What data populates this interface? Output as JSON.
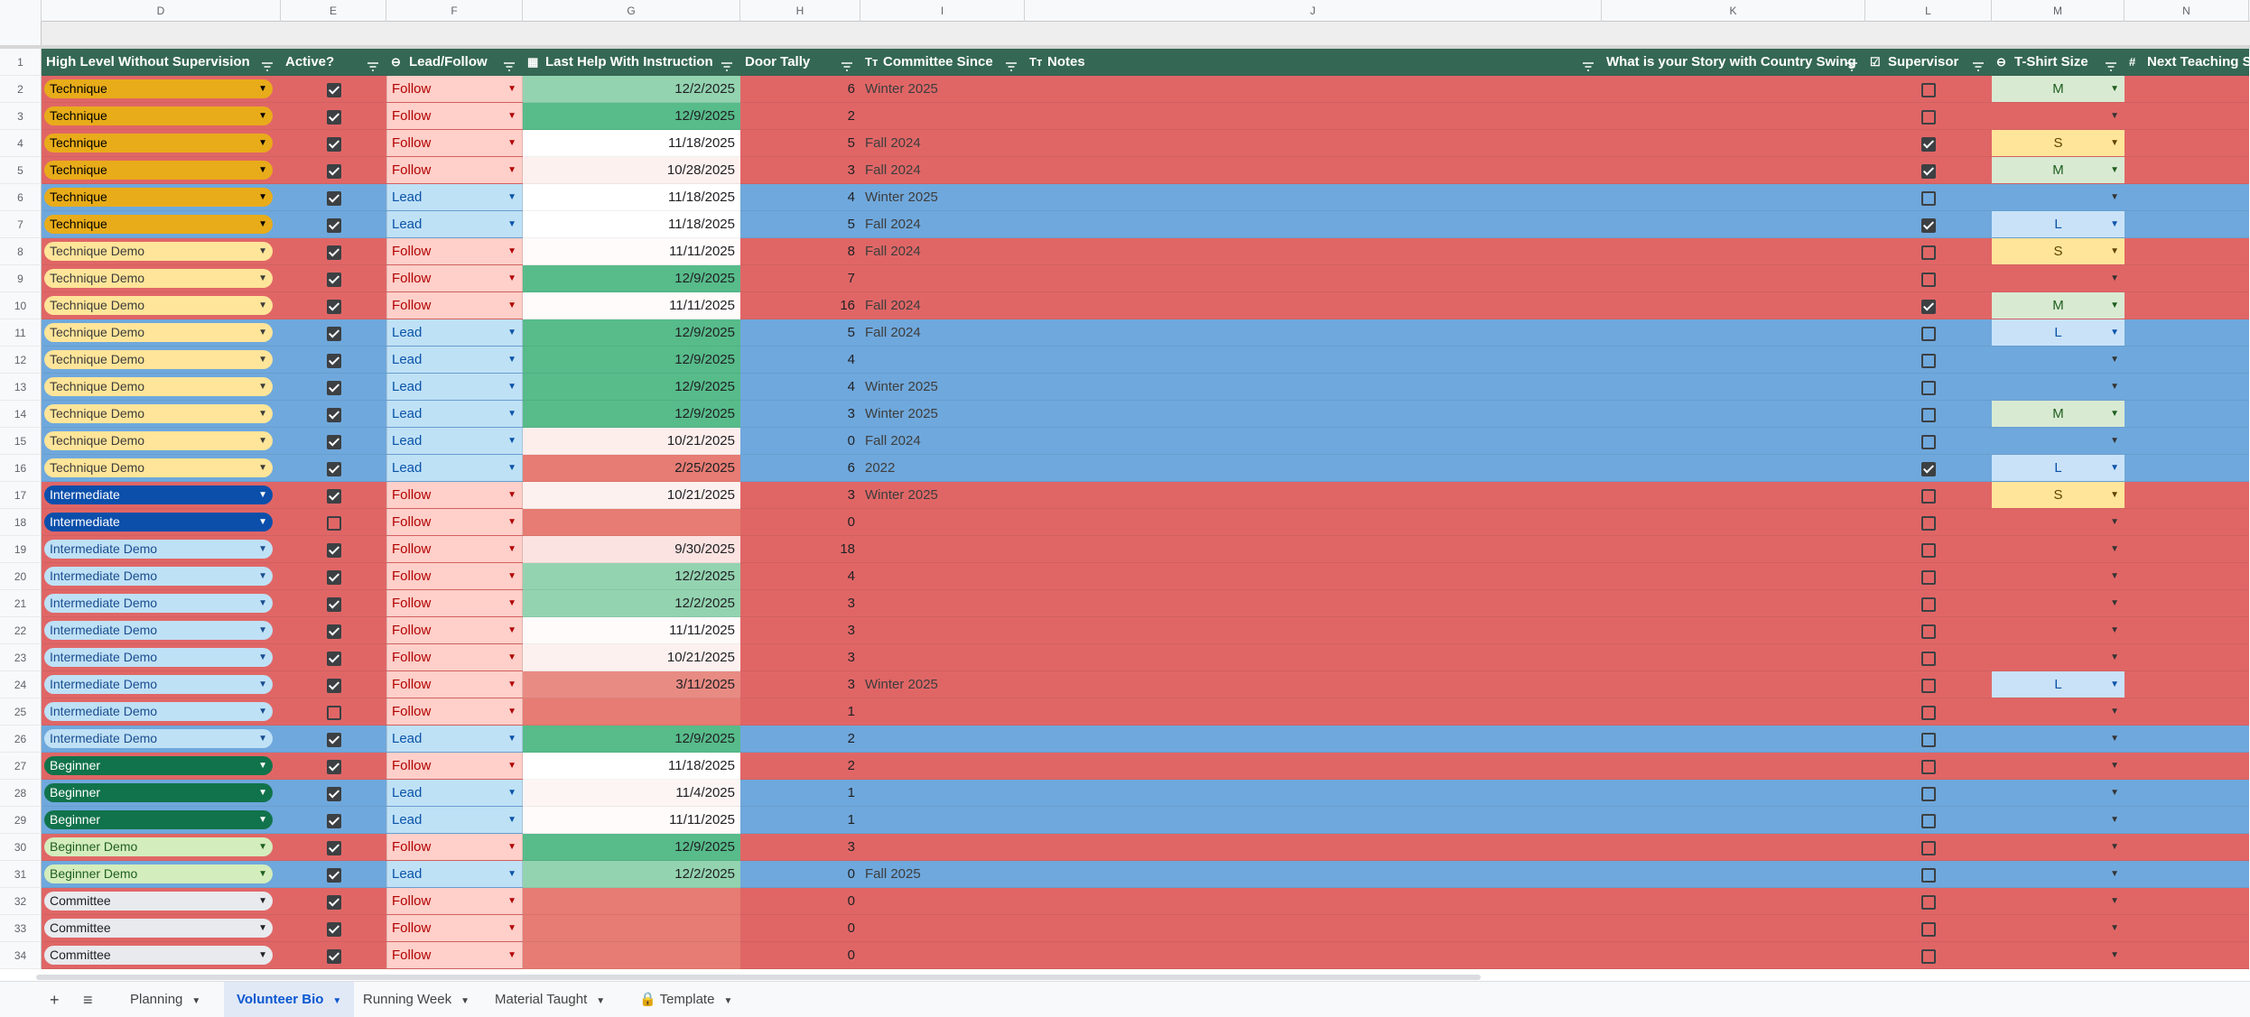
{
  "column_letters": [
    "D",
    "E",
    "F",
    "G",
    "H",
    "I",
    "J",
    "K",
    "L",
    "M",
    "N"
  ],
  "headers": [
    {
      "label": "High Level Without Supervision",
      "icon": ""
    },
    {
      "label": "Active?",
      "icon": ""
    },
    {
      "label": "Lead/Follow",
      "icon": "dropdown-chip-icon"
    },
    {
      "label": "Last Help With Instruction",
      "icon": "calendar-icon"
    },
    {
      "label": "Door Tally",
      "icon": ""
    },
    {
      "label": "Committee Since",
      "icon": "text-type-icon"
    },
    {
      "label": "Notes",
      "icon": "text-type-icon"
    },
    {
      "label": "What is your Story with Country Swing",
      "icon": ""
    },
    {
      "label": "Supervisor",
      "icon": "checkbox-icon"
    },
    {
      "label": "T-Shirt Size",
      "icon": "dropdown-chip-icon"
    },
    {
      "label": "Next Teaching S",
      "icon": "number-icon"
    }
  ],
  "glyphs": {
    "arrow": "▼",
    "check_icon": "☑",
    "number_icon": "#",
    "text_icon": "Tт",
    "calendar_icon": "▦",
    "chip_icon": "⊖"
  },
  "rows": [
    {
      "n": "2",
      "level": "Technique",
      "cls": "tech",
      "active": true,
      "lf": "Follow",
      "date": "12/2/2025",
      "dc": "#93d3b0",
      "tally": "6",
      "since": "Winter 2025",
      "sup": false,
      "size": "M"
    },
    {
      "n": "3",
      "level": "Technique",
      "cls": "tech",
      "active": true,
      "lf": "Follow",
      "date": "12/9/2025",
      "dc": "#57bb8a",
      "tally": "2",
      "since": "",
      "sup": false,
      "size": ""
    },
    {
      "n": "4",
      "level": "Technique",
      "cls": "tech",
      "active": true,
      "lf": "Follow",
      "date": "11/18/2025",
      "dc": "#ffffff",
      "tally": "5",
      "since": "Fall 2024",
      "sup": true,
      "size": "S"
    },
    {
      "n": "5",
      "level": "Technique",
      "cls": "tech",
      "active": true,
      "lf": "Follow",
      "date": "10/28/2025",
      "dc": "#fdf1ef",
      "tally": "3",
      "since": "Fall 2024",
      "sup": true,
      "size": "M"
    },
    {
      "n": "6",
      "level": "Technique",
      "cls": "tech",
      "active": true,
      "lf": "Lead",
      "date": "11/18/2025",
      "dc": "#ffffff",
      "tally": "4",
      "since": "Winter 2025",
      "sup": false,
      "size": ""
    },
    {
      "n": "7",
      "level": "Technique",
      "cls": "tech",
      "active": true,
      "lf": "Lead",
      "date": "11/18/2025",
      "dc": "#ffffff",
      "tally": "5",
      "since": "Fall 2024",
      "sup": true,
      "size": "L"
    },
    {
      "n": "8",
      "level": "Technique Demo",
      "cls": "techdemo",
      "active": true,
      "lf": "Follow",
      "date": "11/11/2025",
      "dc": "#fefbfa",
      "tally": "8",
      "since": "Fall 2024",
      "sup": false,
      "size": "S"
    },
    {
      "n": "9",
      "level": "Technique Demo",
      "cls": "techdemo",
      "active": true,
      "lf": "Follow",
      "date": "12/9/2025",
      "dc": "#57bb8a",
      "tally": "7",
      "since": "",
      "sup": false,
      "size": ""
    },
    {
      "n": "10",
      "level": "Technique Demo",
      "cls": "techdemo",
      "active": true,
      "lf": "Follow",
      "date": "11/11/2025",
      "dc": "#fefbfa",
      "tally": "16",
      "since": "Fall 2024",
      "sup": true,
      "size": "M"
    },
    {
      "n": "11",
      "level": "Technique Demo",
      "cls": "techdemo",
      "active": true,
      "lf": "Lead",
      "date": "12/9/2025",
      "dc": "#57bb8a",
      "tally": "5",
      "since": "Fall 2024",
      "sup": false,
      "size": "L"
    },
    {
      "n": "12",
      "level": "Technique Demo",
      "cls": "techdemo",
      "active": true,
      "lf": "Lead",
      "date": "12/9/2025",
      "dc": "#57bb8a",
      "tally": "4",
      "since": "",
      "sup": false,
      "size": ""
    },
    {
      "n": "13",
      "level": "Technique Demo",
      "cls": "techdemo",
      "active": true,
      "lf": "Lead",
      "date": "12/9/2025",
      "dc": "#57bb8a",
      "tally": "4",
      "since": "Winter 2025",
      "sup": false,
      "size": ""
    },
    {
      "n": "14",
      "level": "Technique Demo",
      "cls": "techdemo",
      "active": true,
      "lf": "Lead",
      "date": "12/9/2025",
      "dc": "#57bb8a",
      "tally": "3",
      "since": "Winter 2025",
      "sup": false,
      "size": "M"
    },
    {
      "n": "15",
      "level": "Technique Demo",
      "cls": "techdemo",
      "active": true,
      "lf": "Lead",
      "date": "10/21/2025",
      "dc": "#fdeeec",
      "tally": "0",
      "since": "Fall 2024",
      "sup": false,
      "size": ""
    },
    {
      "n": "16",
      "level": "Technique Demo",
      "cls": "techdemo",
      "active": true,
      "lf": "Lead",
      "date": "2/25/2025",
      "dc": "#e67c73",
      "tally": "6",
      "since": "2022",
      "sup": true,
      "size": "L"
    },
    {
      "n": "17",
      "level": "Intermediate",
      "cls": "inter",
      "active": true,
      "lf": "Follow",
      "date": "10/21/2025",
      "dc": "#fdf1ef",
      "tally": "3",
      "since": "Winter 2025",
      "sup": false,
      "size": "S"
    },
    {
      "n": "18",
      "level": "Intermediate",
      "cls": "inter",
      "active": false,
      "lf": "Follow",
      "date": "",
      "dc": "#e67c73",
      "tally": "0",
      "since": "",
      "sup": false,
      "size": ""
    },
    {
      "n": "19",
      "level": "Intermediate Demo",
      "cls": "interdemo",
      "active": true,
      "lf": "Follow",
      "date": "9/30/2025",
      "dc": "#fbe3e1",
      "tally": "18",
      "since": "",
      "sup": false,
      "size": ""
    },
    {
      "n": "20",
      "level": "Intermediate Demo",
      "cls": "interdemo",
      "active": true,
      "lf": "Follow",
      "date": "12/2/2025",
      "dc": "#93d3b0",
      "tally": "4",
      "since": "",
      "sup": false,
      "size": ""
    },
    {
      "n": "21",
      "level": "Intermediate Demo",
      "cls": "interdemo",
      "active": true,
      "lf": "Follow",
      "date": "12/2/2025",
      "dc": "#93d3b0",
      "tally": "3",
      "since": "",
      "sup": false,
      "size": ""
    },
    {
      "n": "22",
      "level": "Intermediate Demo",
      "cls": "interdemo",
      "active": true,
      "lf": "Follow",
      "date": "11/11/2025",
      "dc": "#fefbfa",
      "tally": "3",
      "since": "",
      "sup": false,
      "size": ""
    },
    {
      "n": "23",
      "level": "Intermediate Demo",
      "cls": "interdemo",
      "active": true,
      "lf": "Follow",
      "date": "10/21/2025",
      "dc": "#fdf1ef",
      "tally": "3",
      "since": "",
      "sup": false,
      "size": ""
    },
    {
      "n": "24",
      "level": "Intermediate Demo",
      "cls": "interdemo",
      "active": true,
      "lf": "Follow",
      "date": "3/11/2025",
      "dc": "#e88b83",
      "tally": "3",
      "since": "Winter 2025",
      "sup": false,
      "size": "L"
    },
    {
      "n": "25",
      "level": "Intermediate Demo",
      "cls": "interdemo",
      "active": false,
      "lf": "Follow",
      "date": "",
      "dc": "#e67c73",
      "tally": "1",
      "since": "",
      "sup": false,
      "size": ""
    },
    {
      "n": "26",
      "level": "Intermediate Demo",
      "cls": "interdemo",
      "active": true,
      "lf": "Lead",
      "date": "12/9/2025",
      "dc": "#57bb8a",
      "tally": "2",
      "since": "",
      "sup": false,
      "size": ""
    },
    {
      "n": "27",
      "level": "Beginner",
      "cls": "beg",
      "active": true,
      "lf": "Follow",
      "date": "11/18/2025",
      "dc": "#ffffff",
      "tally": "2",
      "since": "",
      "sup": false,
      "size": ""
    },
    {
      "n": "28",
      "level": "Beginner",
      "cls": "beg",
      "active": true,
      "lf": "Lead",
      "date": "11/4/2025",
      "dc": "#fdf5f4",
      "tally": "1",
      "since": "",
      "sup": false,
      "size": ""
    },
    {
      "n": "29",
      "level": "Beginner",
      "cls": "beg",
      "active": true,
      "lf": "Lead",
      "date": "11/11/2025",
      "dc": "#fefbfa",
      "tally": "1",
      "since": "",
      "sup": false,
      "size": ""
    },
    {
      "n": "30",
      "level": "Beginner Demo",
      "cls": "begdemo",
      "active": true,
      "lf": "Follow",
      "date": "12/9/2025",
      "dc": "#57bb8a",
      "tally": "3",
      "since": "",
      "sup": false,
      "size": ""
    },
    {
      "n": "31",
      "level": "Beginner Demo",
      "cls": "begdemo",
      "active": true,
      "lf": "Lead",
      "date": "12/2/2025",
      "dc": "#93d3b0",
      "tally": "0",
      "since": "Fall 2025",
      "sup": false,
      "size": ""
    },
    {
      "n": "32",
      "level": "Committee",
      "cls": "comm",
      "active": true,
      "lf": "Follow",
      "date": "",
      "dc": "#e67c73",
      "tally": "0",
      "since": "",
      "sup": false,
      "size": ""
    },
    {
      "n": "33",
      "level": "Committee",
      "cls": "comm",
      "active": true,
      "lf": "Follow",
      "date": "",
      "dc": "#e67c73",
      "tally": "0",
      "since": "",
      "sup": false,
      "size": ""
    },
    {
      "n": "34",
      "level": "Committee",
      "cls": "comm",
      "active": true,
      "lf": "Follow",
      "date": "",
      "dc": "#e67c73",
      "tally": "0",
      "since": "",
      "sup": false,
      "size": ""
    }
  ],
  "tabs": [
    {
      "label": "Planning",
      "active": false,
      "locked": false
    },
    {
      "label": "Volunteer Bio",
      "active": true,
      "locked": false
    },
    {
      "label": "Running Week",
      "active": false,
      "locked": false
    },
    {
      "label": "Material Taught",
      "active": false,
      "locked": false
    },
    {
      "label": "Template",
      "active": false,
      "locked": true
    }
  ],
  "tabbar": {
    "add": "+",
    "menu": "≡",
    "lock": "🔒"
  },
  "header_row_number": "1"
}
